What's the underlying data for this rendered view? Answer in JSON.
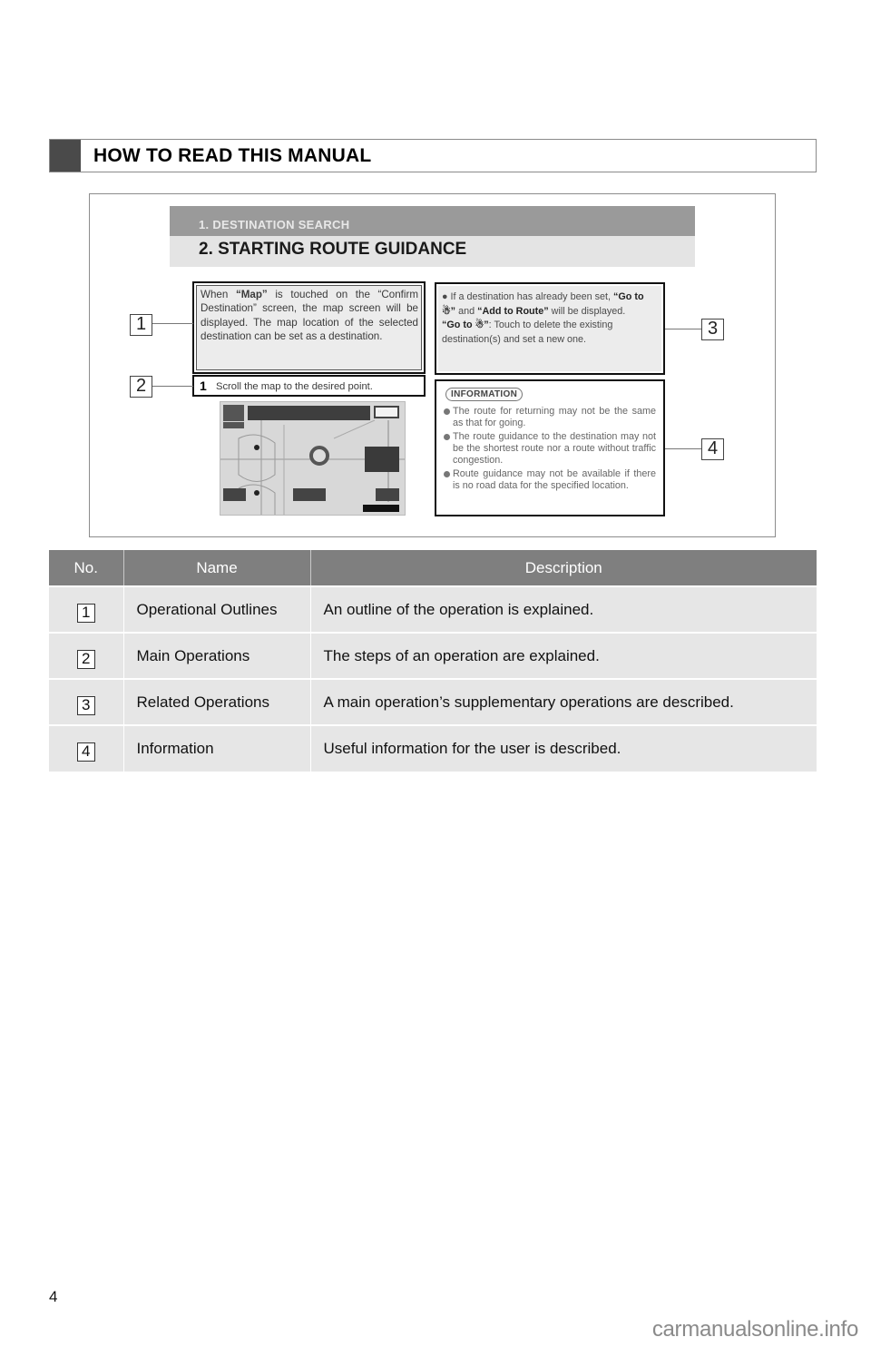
{
  "section": {
    "title": "HOW TO READ THIS MANUAL"
  },
  "figure": {
    "chapter": "1. DESTINATION SEARCH",
    "section_title": "2. STARTING ROUTE GUIDANCE",
    "outline_text_parts": {
      "before": "When ",
      "bold": "“Map”",
      "after": " is touched on the “Confirm Destination” screen, the map screen will be displayed. The map location of the selected destination can be set as a destination."
    },
    "step": {
      "number": "1",
      "text": "Scroll the map to the desired point."
    },
    "related": {
      "bullet_parts": [
        "If a destination has already been set, ",
        "“Go to ☃”",
        " and ",
        "“Add to Route”",
        " will be displayed."
      ],
      "note_bold": "“Go to ☃”",
      "note_text": ": Touch to delete the existing destination(s) and set a new one."
    },
    "information": {
      "badge": "INFORMATION",
      "items": [
        "The route for returning may not be the same as that for going.",
        "The route guidance to the destination may not be the shortest route nor a route without traffic congestion.",
        "Route guidance may not be available if there is no road data for the specified location."
      ]
    },
    "callouts": [
      "1",
      "2",
      "3",
      "4"
    ]
  },
  "table": {
    "headers": [
      "No.",
      "Name",
      "Description"
    ],
    "rows": [
      {
        "no": "1",
        "name": "Operational Outlines",
        "description": "An outline of the operation is explained."
      },
      {
        "no": "2",
        "name": "Main Operations",
        "description": "The steps of an operation are explained."
      },
      {
        "no": "3",
        "name": "Related Operations",
        "description": "A main operation’s supplementary operations are described."
      },
      {
        "no": "4",
        "name": "Information",
        "description": "Useful information for the user is described."
      }
    ]
  },
  "footer": {
    "page_number": "4",
    "watermark": "carmanualsonline.info"
  }
}
